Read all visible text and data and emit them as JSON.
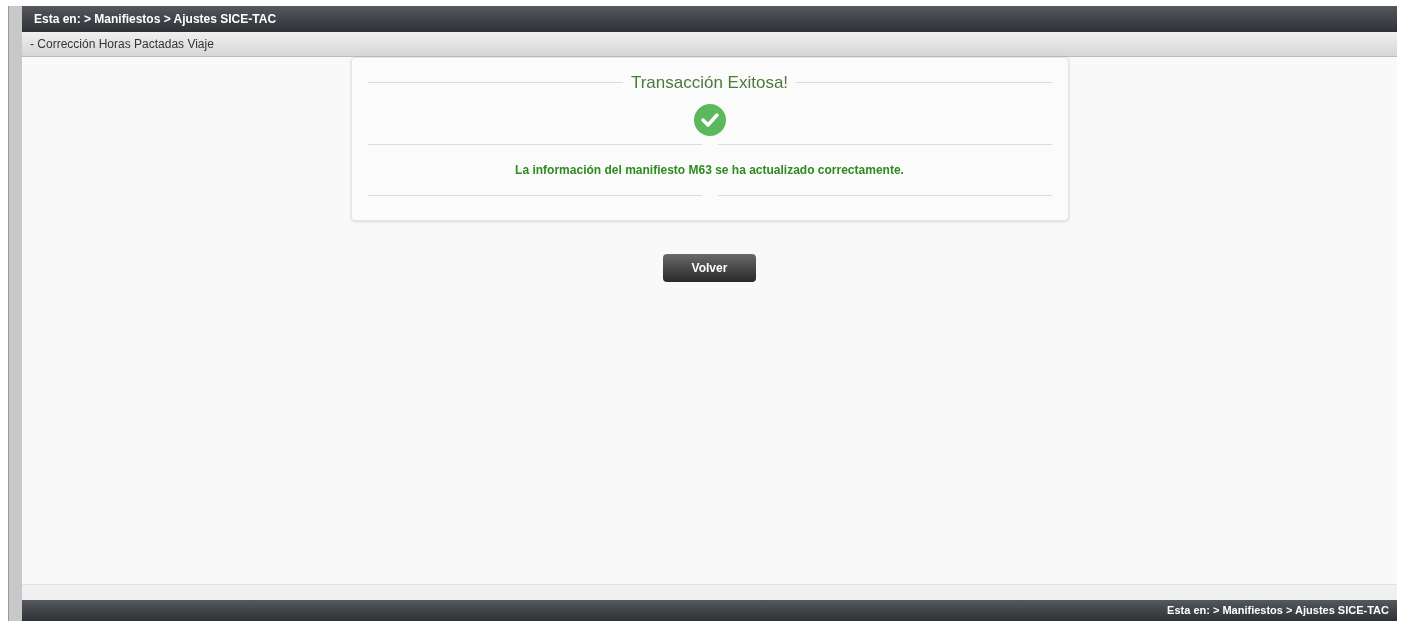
{
  "breadcrumb_top": "Esta en: > Manifiestos > Ajustes SICE-TAC",
  "section": {
    "title": "- Corrección Horas Pactadas Viaje"
  },
  "message_card": {
    "title": "Transacción Exitosa!",
    "message": "La información del manifiesto M63 se ha actualizado correctamente."
  },
  "buttons": [
    {
      "label": "Volver"
    }
  ],
  "breadcrumb_bottom": "Esta en: > Manifiestos > Ajustes SICE-TAC"
}
